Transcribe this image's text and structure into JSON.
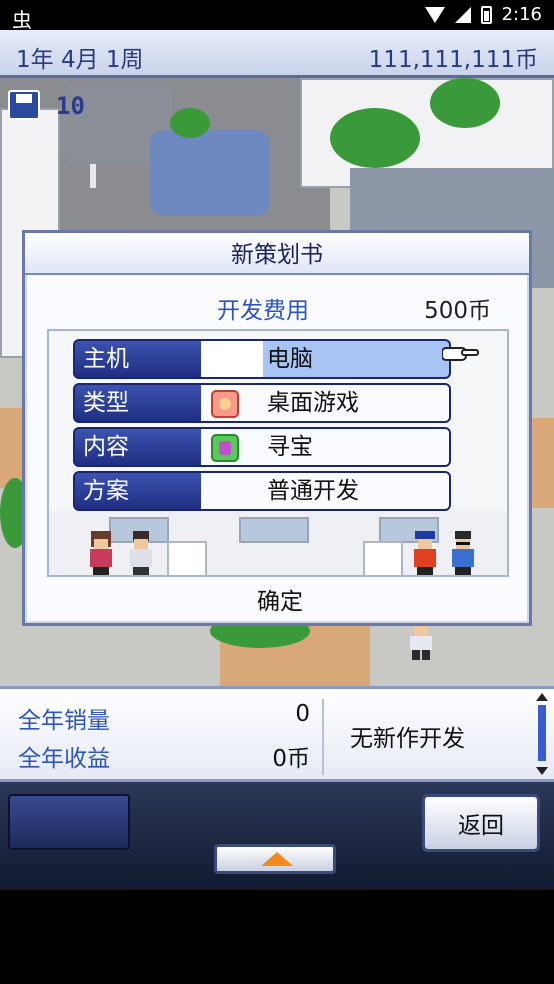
{
  "status_bar": {
    "time": "2:16",
    "app_icon": "bug-icon",
    "icons": [
      "wifi-icon",
      "signal-icon",
      "battery-icon"
    ]
  },
  "top_bar": {
    "date": "1年 4月 1周",
    "money": "111,111,111币"
  },
  "scene": {
    "save_count": "10",
    "save_icon": "floppy-disk-icon"
  },
  "dialog": {
    "title": "新策划书",
    "cost_label": "开发费用",
    "cost_value": "500币",
    "rows": [
      {
        "label": "主机",
        "value": "电脑",
        "icon": "",
        "selected": true
      },
      {
        "label": "类型",
        "value": "桌面游戏",
        "icon": "smiley-face-icon",
        "selected": false
      },
      {
        "label": "内容",
        "value": "寻宝",
        "icon": "purple-gem-icon",
        "selected": false
      },
      {
        "label": "方案",
        "value": "普通开发",
        "icon": "",
        "selected": false
      }
    ],
    "pointer_icon": "pointing-hand-icon",
    "confirm_label": "确定"
  },
  "stats": {
    "annual_sales_label": "全年销量",
    "annual_sales_value": "0",
    "annual_revenue_label": "全年收益",
    "annual_revenue_value": "0币",
    "news": "无新作开发"
  },
  "controls": {
    "back_label": "返回",
    "expand_icon": "up-arrow-icon"
  },
  "colors": {
    "label_bg": "#2a3d98",
    "accent_text": "#2e55b8",
    "expand_arrow": "#f08a20"
  }
}
